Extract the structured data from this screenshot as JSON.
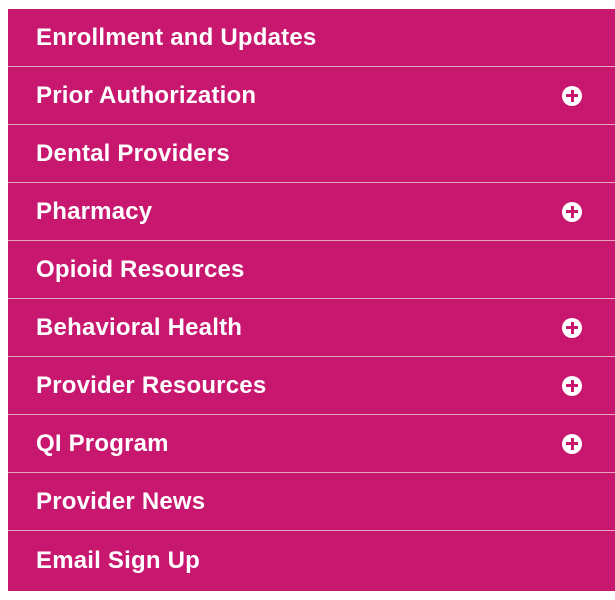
{
  "colors": {
    "menu_background": "#c8176f",
    "menu_text": "#ffffff",
    "divider": "#e9a3c4"
  },
  "menu": {
    "items": [
      {
        "label": "Enrollment and Updates",
        "expandable": false
      },
      {
        "label": "Prior Authorization",
        "expandable": true,
        "icon": "plus-circle-icon"
      },
      {
        "label": "Dental Providers",
        "expandable": false
      },
      {
        "label": "Pharmacy",
        "expandable": true,
        "icon": "plus-circle-icon"
      },
      {
        "label": "Opioid Resources",
        "expandable": false
      },
      {
        "label": "Behavioral Health",
        "expandable": true,
        "icon": "plus-circle-icon"
      },
      {
        "label": "Provider Resources",
        "expandable": true,
        "icon": "plus-circle-icon"
      },
      {
        "label": "QI Program",
        "expandable": true,
        "icon": "plus-circle-icon"
      },
      {
        "label": "Provider News",
        "expandable": false
      },
      {
        "label": "Email Sign Up",
        "expandable": false
      }
    ]
  }
}
